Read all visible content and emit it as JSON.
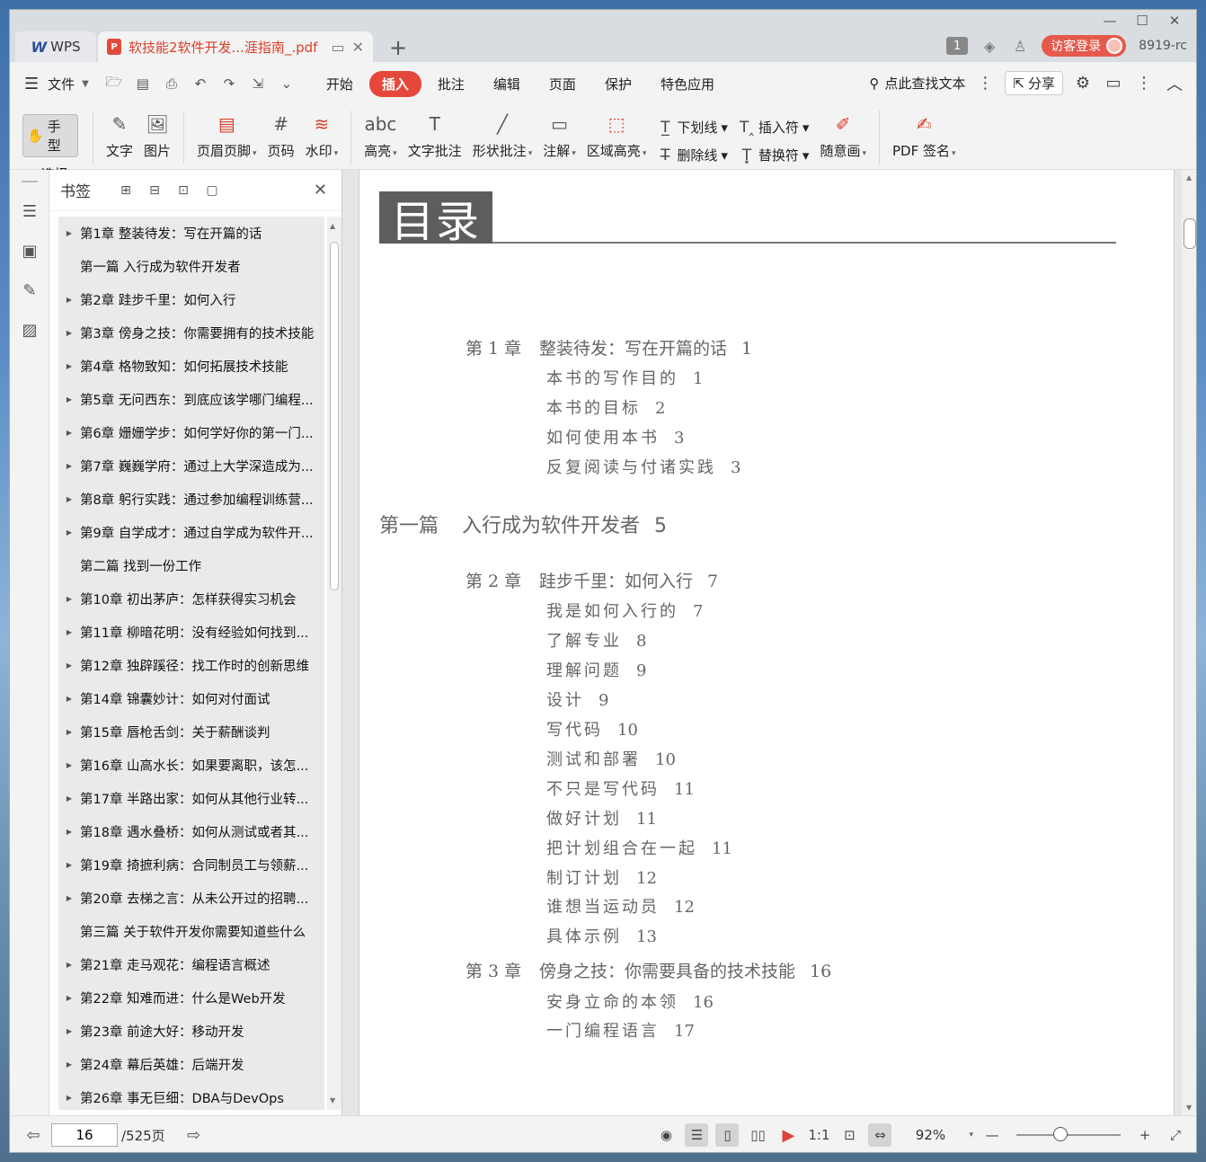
{
  "titlebar": {
    "app_name": "WPS",
    "doc_tab": "软技能2软件开发...涯指南_.pdf",
    "page_badge": "1",
    "login": "访客登录",
    "user_id": "8919-rc"
  },
  "menubar": {
    "file": "文件",
    "tabs": [
      "开始",
      "插入",
      "批注",
      "编辑",
      "页面",
      "保护",
      "特色应用"
    ],
    "active_tab": "插入",
    "search": "点此查找文本",
    "share": "分享"
  },
  "toolbar": {
    "hand": "手型",
    "select": "选择",
    "text": "文字",
    "image": "图片",
    "header_footer": "页眉页脚",
    "page_number": "页码",
    "watermark": "水印",
    "highlight": "高亮",
    "text_comment": "文字批注",
    "shape_comment": "形状批注",
    "annotation": "注解",
    "area_highlight": "区域高亮",
    "underline": "下划线",
    "strikethrough": "删除线",
    "insert_mark": "插入符",
    "replace_mark": "替换符",
    "freehand": "随意画",
    "pdf_sign": "PDF 签名"
  },
  "bookmarks": {
    "title": "书签",
    "items": [
      {
        "label": "第1章 整装待发：写在开篇的话",
        "arrow": true
      },
      {
        "label": "第一篇 入行成为软件开发者",
        "arrow": false
      },
      {
        "label": "第2章 跬步千里：如何入行",
        "arrow": true
      },
      {
        "label": "第3章 傍身之技：你需要拥有的技术技能",
        "arrow": true
      },
      {
        "label": "第4章 格物致知：如何拓展技术技能",
        "arrow": true
      },
      {
        "label": "第5章 无问西东：到底应该学哪门编程...",
        "arrow": true
      },
      {
        "label": "第6章 姗姗学步：如何学好你的第一门...",
        "arrow": true
      },
      {
        "label": "第7章 巍巍学府：通过上大学深造成为...",
        "arrow": true
      },
      {
        "label": "第8章 躬行实践：通过参加编程训练营...",
        "arrow": true
      },
      {
        "label": "第9章 自学成才：通过自学成为软件开...",
        "arrow": true
      },
      {
        "label": "第二篇 找到一份工作",
        "arrow": false
      },
      {
        "label": "第10章 初出茅庐：怎样获得实习机会",
        "arrow": true
      },
      {
        "label": "第11章 柳暗花明：没有经验如何找到...",
        "arrow": true
      },
      {
        "label": "第12章 独辟蹊径：找工作时的创新思维",
        "arrow": true
      },
      {
        "label": "第14章 锦囊妙计：如何对付面试",
        "arrow": true
      },
      {
        "label": "第15章 唇枪舌剑：关于薪酬谈判",
        "arrow": true
      },
      {
        "label": "第16章 山高水长：如果要离职，该怎...",
        "arrow": true
      },
      {
        "label": "第17章 半路出家：如何从其他行业转...",
        "arrow": true
      },
      {
        "label": "第18章 遇水叠桥：如何从测试或者其...",
        "arrow": true
      },
      {
        "label": "第19章 掎摭利病：合同制员工与领薪...",
        "arrow": true
      },
      {
        "label": "第20章 去梯之言：从未公开过的招聘...",
        "arrow": true
      },
      {
        "label": "第三篇 关于软件开发你需要知道些什么",
        "arrow": false
      },
      {
        "label": "第21章 走马观花：编程语言概述",
        "arrow": true
      },
      {
        "label": "第22章 知难而进：什么是Web开发",
        "arrow": true
      },
      {
        "label": "第23章 前途大好：移动开发",
        "arrow": true
      },
      {
        "label": "第24章 幕后英雄：后端开发",
        "arrow": true
      },
      {
        "label": "第26章 事无巨细：DBA与DevOps",
        "arrow": true
      }
    ]
  },
  "document": {
    "toc_title": "目录",
    "entries": [
      {
        "type": "ch",
        "no": "第 1 章",
        "text": "整装待发：写在开篇的话",
        "page": "1"
      },
      {
        "type": "sec",
        "text": "本书的写作目的",
        "page": "1"
      },
      {
        "type": "sec",
        "text": "本书的目标",
        "page": "2"
      },
      {
        "type": "sec",
        "text": "如何使用本书",
        "page": "3"
      },
      {
        "type": "sec",
        "text": "反复阅读与付诸实践",
        "page": "3"
      },
      {
        "type": "part",
        "no": "第一篇",
        "text": "入行成为软件开发者",
        "page": "5"
      },
      {
        "type": "ch",
        "no": "第 2 章",
        "text": "跬步千里：如何入行",
        "page": "7"
      },
      {
        "type": "sec",
        "text": "我是如何入行的",
        "page": "7"
      },
      {
        "type": "sec",
        "text": "了解专业",
        "page": "8"
      },
      {
        "type": "sec",
        "text": "理解问题",
        "page": "9"
      },
      {
        "type": "sec",
        "text": "设计",
        "page": "9"
      },
      {
        "type": "sec",
        "text": "写代码",
        "page": "10"
      },
      {
        "type": "sec",
        "text": "测试和部署",
        "page": "10"
      },
      {
        "type": "sec",
        "text": "不只是写代码",
        "page": "11"
      },
      {
        "type": "sec",
        "text": "做好计划",
        "page": "11"
      },
      {
        "type": "sec",
        "text": "把计划组合在一起",
        "page": "11"
      },
      {
        "type": "sec",
        "text": "制订计划",
        "page": "12"
      },
      {
        "type": "sec",
        "text": "谁想当运动员",
        "page": "12"
      },
      {
        "type": "sec",
        "text": "具体示例",
        "page": "13"
      },
      {
        "type": "ch",
        "no": "第 3 章",
        "text": "傍身之技：你需要具备的技术技能",
        "page": "16"
      },
      {
        "type": "sec",
        "text": "安身立命的本领",
        "page": "16"
      },
      {
        "type": "sec",
        "text": "一门编程语言",
        "page": "17"
      }
    ]
  },
  "statusbar": {
    "current_page": "16",
    "total_pages": "/525页",
    "zoom": "92%",
    "zoom_fraction": 0.42
  }
}
